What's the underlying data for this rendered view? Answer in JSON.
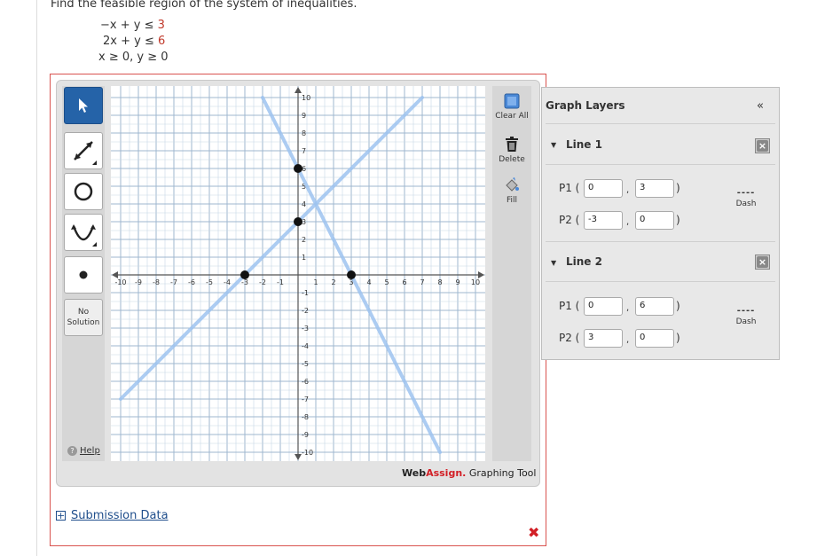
{
  "question": {
    "prompt": "Find the feasible region of the system of inequalities.",
    "ineq1_lhs": "−x + y ≤ ",
    "ineq1_rhs": "3",
    "ineq2_lhs": "2x + y ≤ ",
    "ineq2_rhs": "6",
    "ineq3": "x ≥ 0, y ≥ 0"
  },
  "toolbar": {
    "no_solution_line1": "No",
    "no_solution_line2": "Solution",
    "help_label": "Help",
    "clear_all_label": "Clear All",
    "delete_label": "Delete",
    "fill_label": "Fill"
  },
  "branding": {
    "web": "Web",
    "assign": "Assign.",
    "tool": " Graphing Tool"
  },
  "submission_data_label": "Submission Data",
  "layers": {
    "title": "Graph Layers",
    "collapse_glyph": "«",
    "close_glyph": "×",
    "dash_label": "Dash",
    "dash_glyph": "----",
    "line1": {
      "title": "Line 1",
      "p1_label": "P1 (",
      "p1_x": "0",
      "p1_y": "3",
      "p2_label": "P2 (",
      "p2_x": "-3",
      "p2_y": "0"
    },
    "line2": {
      "title": "Line 2",
      "p1_label": "P1 (",
      "p1_x": "0",
      "p1_y": "6",
      "p2_label": "P2 (",
      "p2_x": "3",
      "p2_y": "0"
    }
  },
  "colors": {
    "active_tool": "#2563a8",
    "line": "#9ec4f0",
    "grid_major": "#9fb7cf",
    "grid_minor": "#c7d7e6",
    "point": "#111111",
    "accent_red": "#d21f26"
  },
  "chart_data": {
    "type": "line",
    "xlim": [
      -10,
      10
    ],
    "ylim": [
      -10,
      10
    ],
    "x_ticks": [
      -10,
      -9,
      -8,
      -7,
      -6,
      -5,
      -4,
      -3,
      -2,
      -1,
      1,
      2,
      3,
      4,
      5,
      6,
      7,
      8,
      9,
      10
    ],
    "y_ticks": [
      -10,
      -9,
      -8,
      -7,
      -6,
      -5,
      -4,
      -3,
      -2,
      -1,
      1,
      2,
      3,
      4,
      5,
      6,
      7,
      8,
      9,
      10
    ],
    "grid": true,
    "lines": [
      {
        "points": [
          [
            0,
            3
          ],
          [
            -3,
            0
          ]
        ]
      },
      {
        "points": [
          [
            0,
            6
          ],
          [
            3,
            0
          ]
        ]
      }
    ],
    "points": [
      [
        0,
        3
      ],
      [
        -3,
        0
      ],
      [
        0,
        6
      ],
      [
        3,
        0
      ]
    ]
  }
}
